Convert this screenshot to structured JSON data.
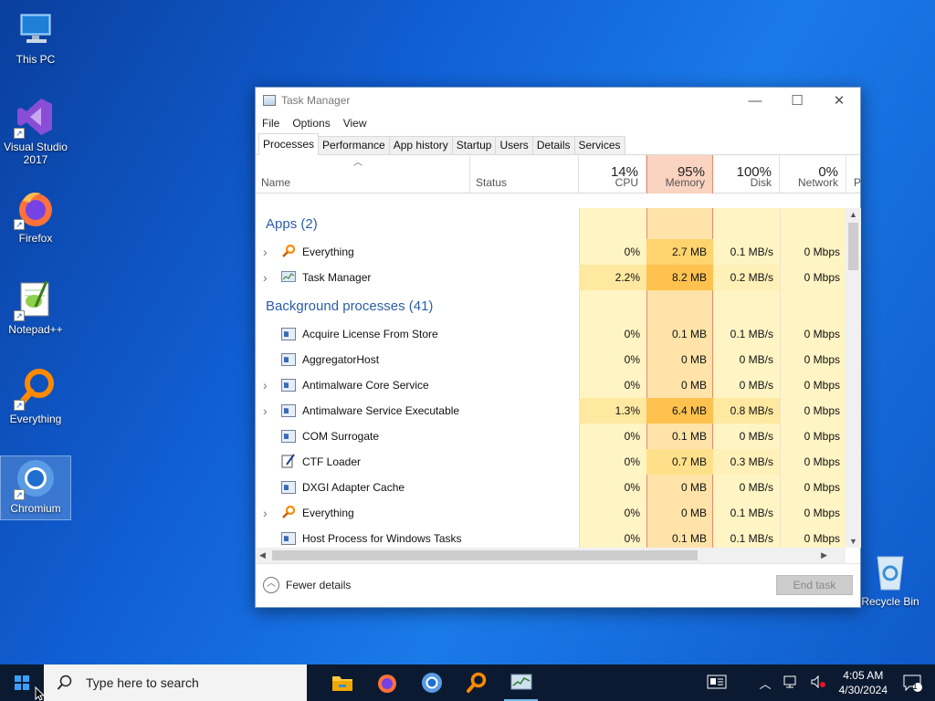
{
  "desktop": {
    "icons": [
      {
        "label": "This PC",
        "icon": "computer-icon"
      },
      {
        "label": "Visual Studio 2017",
        "icon": "visual-studio-icon"
      },
      {
        "label": "Firefox",
        "icon": "firefox-icon"
      },
      {
        "label": "Notepad++",
        "icon": "notepadpp-icon"
      },
      {
        "label": "Everything",
        "icon": "everything-icon"
      },
      {
        "label": "Chromium",
        "icon": "chromium-icon"
      },
      {
        "label": "Recycle Bin",
        "icon": "recycle-bin-icon"
      }
    ]
  },
  "window": {
    "title": "Task Manager",
    "menu": [
      "File",
      "Options",
      "View"
    ],
    "tabs": [
      "Processes",
      "Performance",
      "App history",
      "Startup",
      "Users",
      "Details",
      "Services"
    ],
    "active_tab": "Processes",
    "columns": {
      "name": "Name",
      "status": "Status",
      "cpu": {
        "pct": "14%",
        "label": "CPU"
      },
      "memory": {
        "pct": "95%",
        "label": "Memory"
      },
      "disk": {
        "pct": "100%",
        "label": "Disk"
      },
      "network": {
        "pct": "0%",
        "label": "Network"
      },
      "power": "P"
    },
    "groups": [
      {
        "title": "Apps (2)",
        "rows": [
          {
            "name": "Everything",
            "expandable": true,
            "icon": "everything-icon",
            "cpu": "0%",
            "memory": "2.7 MB",
            "disk": "0.1 MB/s",
            "network": "0 Mbps"
          },
          {
            "name": "Task Manager",
            "expandable": true,
            "icon": "task-manager-icon",
            "cpu": "2.2%",
            "memory": "8.2 MB",
            "disk": "0.2 MB/s",
            "network": "0 Mbps"
          }
        ]
      },
      {
        "title": "Background processes (41)",
        "rows": [
          {
            "name": "Acquire License From Store",
            "expandable": false,
            "icon": "process-icon",
            "cpu": "0%",
            "memory": "0.1 MB",
            "disk": "0.1 MB/s",
            "network": "0 Mbps"
          },
          {
            "name": "AggregatorHost",
            "expandable": false,
            "icon": "process-icon",
            "cpu": "0%",
            "memory": "0 MB",
            "disk": "0 MB/s",
            "network": "0 Mbps"
          },
          {
            "name": "Antimalware Core Service",
            "expandable": true,
            "icon": "process-icon",
            "cpu": "0%",
            "memory": "0 MB",
            "disk": "0 MB/s",
            "network": "0 Mbps"
          },
          {
            "name": "Antimalware Service Executable",
            "expandable": true,
            "icon": "process-icon",
            "cpu": "1.3%",
            "memory": "6.4 MB",
            "disk": "0.8 MB/s",
            "network": "0 Mbps"
          },
          {
            "name": "COM Surrogate",
            "expandable": false,
            "icon": "process-icon",
            "cpu": "0%",
            "memory": "0.1 MB",
            "disk": "0 MB/s",
            "network": "0 Mbps"
          },
          {
            "name": "CTF Loader",
            "expandable": false,
            "icon": "ctf-loader-icon",
            "cpu": "0%",
            "memory": "0.7 MB",
            "disk": "0.3 MB/s",
            "network": "0 Mbps"
          },
          {
            "name": "DXGI Adapter Cache",
            "expandable": false,
            "icon": "process-icon",
            "cpu": "0%",
            "memory": "0 MB",
            "disk": "0 MB/s",
            "network": "0 Mbps"
          },
          {
            "name": "Everything",
            "expandable": true,
            "icon": "everything-icon",
            "cpu": "0%",
            "memory": "0 MB",
            "disk": "0.1 MB/s",
            "network": "0 Mbps"
          },
          {
            "name": "Host Process for Windows Tasks",
            "expandable": false,
            "icon": "process-icon",
            "cpu": "0%",
            "memory": "0.1 MB",
            "disk": "0.1 MB/s",
            "network": "0 Mbps"
          }
        ]
      }
    ],
    "footer": {
      "fewer_details": "Fewer details",
      "end_task": "End task"
    }
  },
  "taskbar": {
    "search_placeholder": "Type here to search",
    "pinned": [
      "file-explorer-icon",
      "firefox-icon",
      "chromium-icon",
      "everything-icon",
      "task-manager-icon"
    ],
    "time": "4:05 AM",
    "date": "4/30/2024",
    "notification_count": "1"
  },
  "colors": {
    "memory_header_bg": "#fbd3c1",
    "heat_light": "#fff4c4",
    "heat_med": "#ffe8a0",
    "heat_high": "#ffd36e",
    "group_title": "#2a5ea8"
  }
}
